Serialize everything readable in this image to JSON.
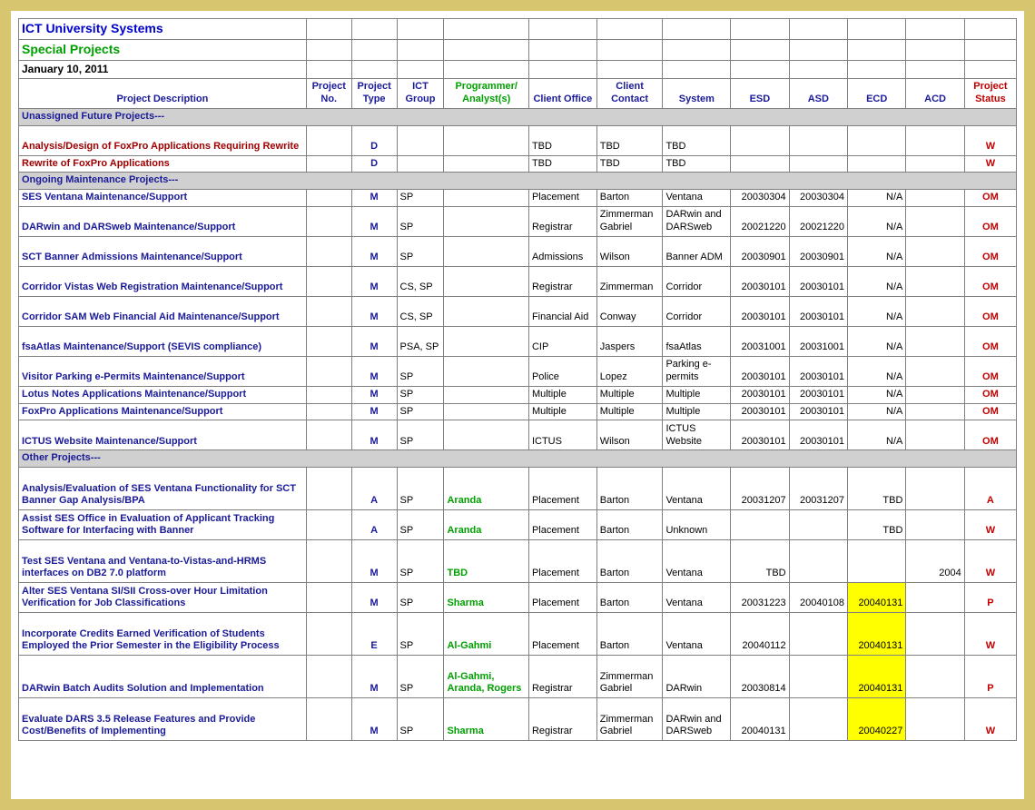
{
  "header": {
    "title": "ICT University Systems",
    "subtitle": "Special Projects",
    "date": "January 10, 2011"
  },
  "columns": [
    "Project Description",
    "Project No.",
    "Project Type",
    "ICT Group",
    "Programmer/ Analyst(s)",
    "Client Office",
    "Client Contact",
    "System",
    "ESD",
    "ASD",
    "ECD",
    "ACD",
    "Project Status"
  ],
  "sections": [
    {
      "label": "Unassigned Future Projects---",
      "rows": [
        {
          "desc": "Analysis/Design of FoxPro Applications Requiring Rewrite",
          "descClass": "desc-red",
          "ptype": "D",
          "grp": "",
          "prog": "",
          "coff": "TBD",
          "ccon": "TBD",
          "sys": "TBD",
          "esd": "",
          "asd": "",
          "ecd": "",
          "acd": "",
          "stat": "W",
          "tall": true
        },
        {
          "desc": "Rewrite of FoxPro Applications",
          "descClass": "desc-red",
          "ptype": "D",
          "grp": "",
          "prog": "",
          "coff": "TBD",
          "ccon": "TBD",
          "sys": "TBD",
          "esd": "",
          "asd": "",
          "ecd": "",
          "acd": "",
          "stat": "W"
        }
      ]
    },
    {
      "label": "Ongoing Maintenance Projects---",
      "rows": [
        {
          "desc": "SES Ventana Maintenance/Support",
          "ptype": "M",
          "grp": "SP",
          "prog": "",
          "coff": "Placement",
          "ccon": "Barton",
          "sys": "Ventana",
          "esd": "20030304",
          "asd": "20030304",
          "ecd": "N/A",
          "acd": "",
          "stat": "OM"
        },
        {
          "desc": "DARwin and DARSweb Maintenance/Support",
          "ptype": "M",
          "grp": "SP",
          "prog": "",
          "coff": "Registrar",
          "ccon": "Zimmerman Gabriel",
          "sys": "DARwin and DARSweb",
          "esd": "20021220",
          "asd": "20021220",
          "ecd": "N/A",
          "acd": "",
          "stat": "OM",
          "tall": true
        },
        {
          "desc": "SCT Banner Admissions Maintenance/Support",
          "ptype": "M",
          "grp": "SP",
          "prog": "",
          "coff": "Admissions",
          "ccon": "Wilson",
          "sys": "Banner ADM",
          "esd": "20030901",
          "asd": "20030901",
          "ecd": "N/A",
          "acd": "",
          "stat": "OM",
          "tall": true
        },
        {
          "desc": "Corridor Vistas Web Registration Maintenance/Support",
          "ptype": "M",
          "grp": "CS, SP",
          "prog": "",
          "coff": "Registrar",
          "ccon": "Zimmerman",
          "sys": "Corridor",
          "esd": "20030101",
          "asd": "20030101",
          "ecd": "N/A",
          "acd": "",
          "stat": "OM",
          "tall": true
        },
        {
          "desc": "Corridor SAM Web Financial Aid Maintenance/Support",
          "ptype": "M",
          "grp": "CS, SP",
          "prog": "",
          "coff": "Financial Aid",
          "ccon": "Conway",
          "sys": "Corridor",
          "esd": "20030101",
          "asd": "20030101",
          "ecd": "N/A",
          "acd": "",
          "stat": "OM",
          "tall": true
        },
        {
          "desc": "fsaAtlas Maintenance/Support (SEVIS compliance)",
          "ptype": "M",
          "grp": "PSA, SP",
          "prog": "",
          "coff": "CIP",
          "ccon": "Jaspers",
          "sys": "fsaAtlas",
          "esd": "20031001",
          "asd": "20031001",
          "ecd": "N/A",
          "acd": "",
          "stat": "OM",
          "tall": true
        },
        {
          "desc": "Visitor Parking e-Permits Maintenance/Support",
          "ptype": "M",
          "grp": "SP",
          "prog": "",
          "coff": "Police",
          "ccon": "Lopez",
          "sys": "Parking e-permits",
          "esd": "20030101",
          "asd": "20030101",
          "ecd": "N/A",
          "acd": "",
          "stat": "OM",
          "tall": true
        },
        {
          "desc": "Lotus Notes Applications Maintenance/Support",
          "ptype": "M",
          "grp": "SP",
          "prog": "",
          "coff": "Multiple",
          "ccon": "Multiple",
          "sys": "Multiple",
          "esd": "20030101",
          "asd": "20030101",
          "ecd": "N/A",
          "acd": "",
          "stat": "OM"
        },
        {
          "desc": "FoxPro Applications Maintenance/Support",
          "ptype": "M",
          "grp": "SP",
          "prog": "",
          "coff": "Multiple",
          "ccon": "Multiple",
          "sys": "Multiple",
          "esd": "20030101",
          "asd": "20030101",
          "ecd": "N/A",
          "acd": "",
          "stat": "OM"
        },
        {
          "desc": "ICTUS Website Maintenance/Support",
          "ptype": "M",
          "grp": "SP",
          "prog": "",
          "coff": "ICTUS",
          "ccon": "Wilson",
          "sys": "ICTUS Website",
          "esd": "20030101",
          "asd": "20030101",
          "ecd": "N/A",
          "acd": "",
          "stat": "OM",
          "tall": true
        }
      ]
    },
    {
      "label": "Other Projects---",
      "rows": [
        {
          "desc": "Analysis/Evaluation of SES Ventana Functionality for SCT Banner Gap Analysis/BPA",
          "ptype": "A",
          "grp": "SP",
          "prog": "Aranda",
          "coff": "Placement",
          "ccon": "Barton",
          "sys": "Ventana",
          "esd": "20031207",
          "asd": "20031207",
          "ecd": "TBD",
          "acd": "",
          "stat": "A",
          "tall3": true
        },
        {
          "desc": "Assist SES Office in Evaluation of Applicant Tracking Software for Interfacing with Banner",
          "ptype": "A",
          "grp": "SP",
          "prog": "Aranda",
          "coff": "Placement",
          "ccon": "Barton",
          "sys": "Unknown",
          "esd": "",
          "asd": "",
          "ecd": "TBD",
          "acd": "",
          "stat": "W",
          "tall": true
        },
        {
          "desc": "Test SES Ventana and Ventana-to-Vistas-and-HRMS interfaces on DB2 7.0 platform",
          "ptype": "M",
          "grp": "SP",
          "prog": "TBD",
          "coff": "Placement",
          "ccon": "Barton",
          "sys": "Ventana",
          "esd": "TBD",
          "asd": "",
          "ecd": "",
          "acd": "2004",
          "stat": "W",
          "tall3": true
        },
        {
          "desc": "Alter SES Ventana SI/SII Cross-over Hour Limitation Verification for Job Classifications",
          "ptype": "M",
          "grp": "SP",
          "prog": "Sharma",
          "coff": "Placement",
          "ccon": "Barton",
          "sys": "Ventana",
          "esd": "20031223",
          "asd": "20040108",
          "ecd": "20040131",
          "ecdHL": true,
          "acd": "",
          "stat": "P",
          "tall": true
        },
        {
          "desc": "Incorporate Credits Earned Verification of Students Employed the Prior Semester in the Eligibility Process",
          "ptype": "E",
          "grp": "SP",
          "prog": "Al-Gahmi",
          "coff": "Placement",
          "ccon": "Barton",
          "sys": "Ventana",
          "esd": "20040112",
          "asd": "",
          "ecd": "20040131",
          "ecdHL": true,
          "acd": "",
          "stat": "W",
          "tall3": true
        },
        {
          "desc": "DARwin Batch Audits Solution and Implementation",
          "ptype": "M",
          "grp": "SP",
          "prog": "Al-Gahmi, Aranda, Rogers",
          "coff": "Registrar",
          "ccon": "Zimmerman Gabriel",
          "sys": "DARwin",
          "esd": "20030814",
          "asd": "",
          "ecd": "20040131",
          "ecdHL": true,
          "acd": "",
          "stat": "P",
          "tall3": true
        },
        {
          "desc": "Evaluate DARS 3.5 Release Features and Provide Cost/Benefits of Implementing",
          "ptype": "M",
          "grp": "SP",
          "prog": "Sharma",
          "coff": "Registrar",
          "ccon": "Zimmerman Gabriel",
          "sys": "DARwin and DARSweb",
          "esd": "20040131",
          "asd": "",
          "ecd": "20040227",
          "ecdHL": true,
          "acd": "",
          "stat": "W",
          "tall3": true
        }
      ]
    }
  ]
}
